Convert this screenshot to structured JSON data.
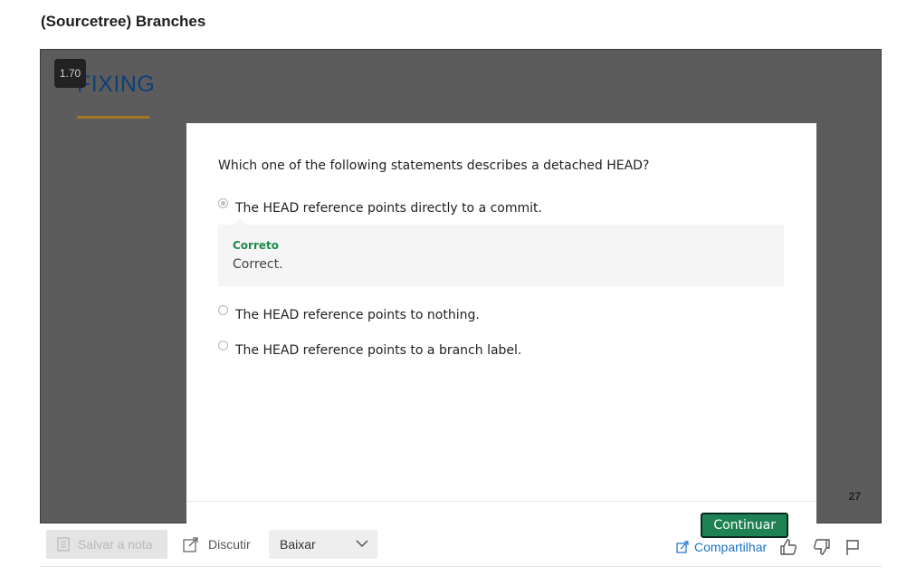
{
  "page": {
    "title": "(Sourcetree) Branches"
  },
  "video": {
    "speed": "1.70",
    "slide_heading": "FIXING",
    "slide_number": "27"
  },
  "quiz": {
    "question": "Which one of the following statements describes a detached HEAD?",
    "options": [
      {
        "label": "The HEAD reference points directly to a commit.",
        "selected": true
      },
      {
        "label": "The HEAD reference points to nothing.",
        "selected": false
      },
      {
        "label": "The HEAD reference points to a branch label.",
        "selected": false
      }
    ],
    "feedback": {
      "title": "Correto",
      "text": "Correct."
    },
    "continue_label": "Continuar"
  },
  "toolbar": {
    "save_note": "Salvar a nota",
    "discuss": "Discutir",
    "download": "Baixar",
    "share": "Compartilhar",
    "icons": [
      "note-icon",
      "external-link-icon",
      "chevron-down-icon",
      "share-icon",
      "thumbs-up-icon",
      "thumbs-down-icon",
      "flag-icon"
    ]
  },
  "colors": {
    "accent_green": "#1f8254",
    "feedback_green": "#1f8a4c",
    "link_blue": "#1a73c7"
  }
}
